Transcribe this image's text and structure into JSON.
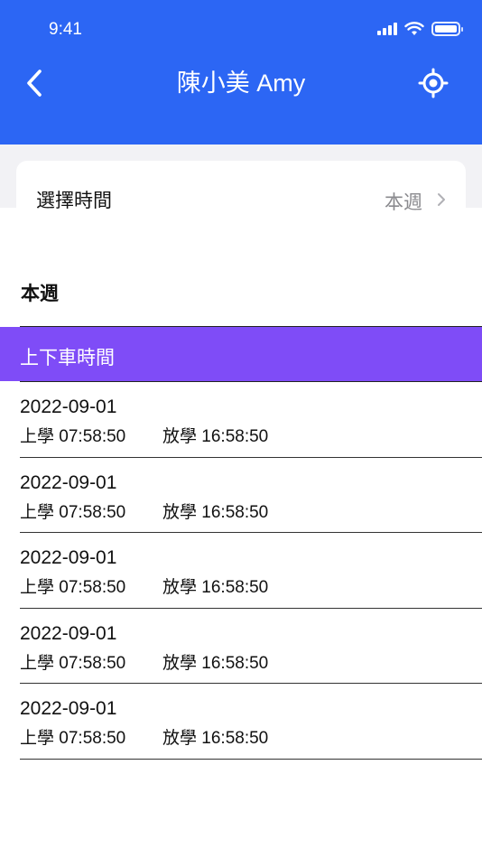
{
  "status_bar": {
    "time": "9:41"
  },
  "header": {
    "title": "陳小美 Amy",
    "back_icon": "chevron-left-icon",
    "locate_icon": "crosshair-icon"
  },
  "time_selector": {
    "label": "選擇時間",
    "value": "本週"
  },
  "section": {
    "title": "本週"
  },
  "table_header": {
    "label": "上下車時間"
  },
  "records": [
    {
      "date": "2022-09-01",
      "board": "上學 07:58:50",
      "alight": "放學 16:58:50"
    },
    {
      "date": "2022-09-01",
      "board": "上學 07:58:50",
      "alight": "放學 16:58:50"
    },
    {
      "date": "2022-09-01",
      "board": "上學 07:58:50",
      "alight": "放學 16:58:50"
    },
    {
      "date": "2022-09-01",
      "board": "上學 07:58:50",
      "alight": "放學 16:58:50"
    },
    {
      "date": "2022-09-01",
      "board": "上學 07:58:50",
      "alight": "放學 16:58:50"
    }
  ],
  "colors": {
    "header_bg": "#2c66f4",
    "table_header_bg": "#7f4cf7"
  }
}
